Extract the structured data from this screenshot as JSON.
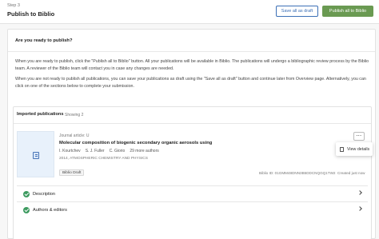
{
  "header": {
    "step": "Step 3",
    "title": "Publish to Biblio",
    "save_draft_label": "Save all as draft",
    "publish_label": "Publish all to Biblio"
  },
  "ready": {
    "heading": "Are you ready to publish?",
    "paragraph1": "When you are ready to publish, click the \"Publish all to Biblio\" button. All your publications will be available in Biblio. The publications will undergo a bibliographic review process by the Biblio team. A reviewer of the Biblio team will contact you in case any changes are needed.",
    "paragraph2": "When you are not ready to publish all publications, you can save your publications as draft using the \"Save all as draft\" button and continue later from Overview page. Alternatively, you can click on one of the sections below to complete your submission."
  },
  "imported": {
    "heading": "Imported publications",
    "count": "Showing 2",
    "publication": {
      "type": "Journal article: U",
      "title": "Molecular composition of biogenic secondary organic aerosols using",
      "authors": [
        "I. Kourtchev",
        "S. J. Fuller",
        "C. Giorio"
      ],
      "more_authors": "29 more authors",
      "journal": "2014, ATMOSPHERIC CHEMISTRY AND PHYSICS",
      "status": "Biblio Draft",
      "biblio_id": "Biblio ID: 01GMM48DNN3B5DDCNQGQ1TW2",
      "created": "Created just now"
    },
    "menu": {
      "view_details": "View details"
    },
    "sections": [
      {
        "label": "Description"
      },
      {
        "label": "Authors & editors"
      }
    ]
  },
  "colors": {
    "primary": "#3b6fb6",
    "publish": "#6a9a52",
    "success": "#3c9a5f"
  }
}
